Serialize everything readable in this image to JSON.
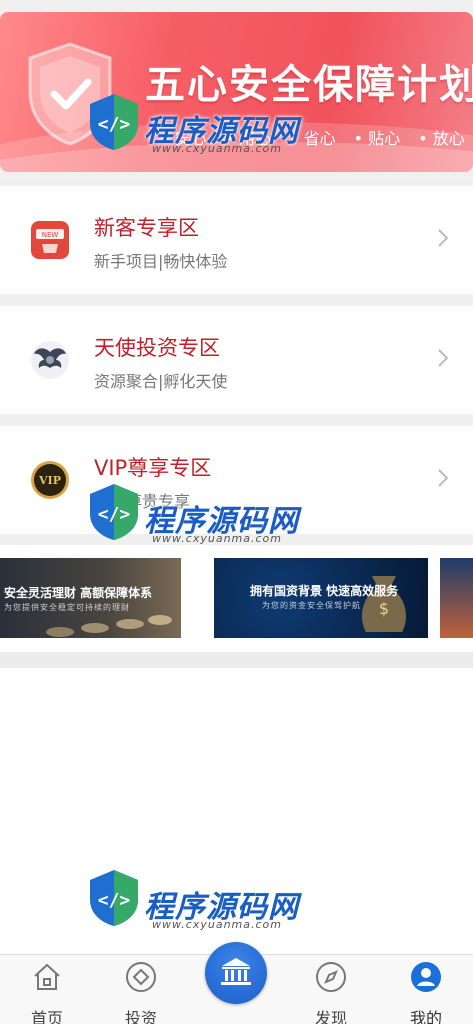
{
  "banner": {
    "title": "五心安全保障计划",
    "tags": [
      "安心",
      "用心",
      "省心",
      "贴心",
      "放心"
    ]
  },
  "zones": [
    {
      "title": "新客专享区",
      "subtitle": "新手项目|畅快体验",
      "icon": "new-customer-icon"
    },
    {
      "title": "天使投资专区",
      "subtitle": "资源聚合|孵化天使",
      "icon": "angel-wings-icon"
    },
    {
      "title": "VIP尊享专区",
      "subtitle": "用户尊贵专享",
      "icon": "vip-badge-icon"
    }
  ],
  "carousel": [
    {
      "title": "安全灵活理财 高额保障体系",
      "subtitle": "为您提供安全稳定可持续的理财"
    },
    {
      "title": "拥有国资背景 快速高效服务",
      "subtitle": "为您的资金安全保驾护航"
    }
  ],
  "watermark": {
    "text": "程序源码网",
    "url": "www.cxyuanma.com"
  },
  "tabbar": {
    "items": [
      {
        "label": "首页",
        "icon": "home-icon"
      },
      {
        "label": "投资",
        "icon": "invest-icon"
      },
      {
        "label": "",
        "icon": "bank-icon"
      },
      {
        "label": "发现",
        "icon": "compass-icon"
      },
      {
        "label": "我的",
        "icon": "user-icon"
      }
    ]
  },
  "colors": {
    "accent_red": "#c0212b",
    "banner_red": "#f1535d",
    "tab_blue": "#1b5ec9"
  }
}
